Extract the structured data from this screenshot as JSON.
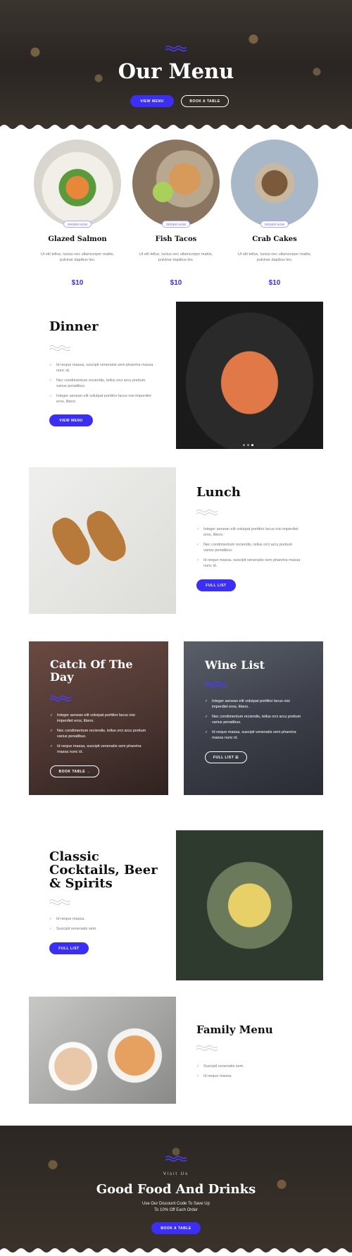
{
  "hero": {
    "title": "Our Menu",
    "view_menu": "VIEW MENU",
    "book_table": "BOOK A TABLE"
  },
  "dishes": [
    {
      "name": "Glazed Salmon",
      "desc": "Ut elit tellus, luctus nec ullamcorper mattis, pulvinar dapibus leo.",
      "price": "$10",
      "order": "ORDER NOW"
    },
    {
      "name": "Fish Tacos",
      "desc": "Ut elit tellus, luctus nec ullamcorper mattis, pulvinar dapibus leo.",
      "price": "$10",
      "order": "ORDER NOW"
    },
    {
      "name": "Crab Cakes",
      "desc": "Ut elit tellus, luctus nec ullamcorper mattis, pulvinar dapibus leo.",
      "price": "$10",
      "order": "ORDER NOW"
    }
  ],
  "dinner": {
    "title": "Dinner",
    "items": [
      "Id neque massa, suscipit venenatis sem pharetra massa nunc id.",
      "Nec condimentum reciendis, tellus orci arcu pretium varius penatibus.",
      "Integer aenean elit volutpat porttitor lacus nisi imperdiet eros, libero."
    ],
    "button": "VIEW MENU"
  },
  "lunch": {
    "title": "Lunch",
    "items": [
      "Integer aenean elit volutpat porttitor lacus nisi imperdiet eros, libero.",
      "Nec condimentum reciendis, tellus orci arcu pretium varius penatibus.",
      "Id neque massa, suscipit venenatis sem pharetra massa nunc id."
    ],
    "button": "FULL LIST"
  },
  "catch": {
    "title": "Catch Of The Day",
    "items": [
      "Integer aenean elit volutpat porttitor lacus nisi imperdiet eros, libero.",
      "Nec condimentum reciendis, tellus orci arcu pretium varius penatibus.",
      "Id neque massa, suscipit venenatis sem pharetra massa nunc id."
    ],
    "button": "BOOK TABLE →"
  },
  "wine": {
    "title": "Wine List",
    "items": [
      "Integer aenean elit volutpat porttitor lacus nisi imperdiet eros, libero.",
      "Nec condimentum reciendis, tellus orci arcu pretium varius penatibus.",
      "Id neque massa, suscipit venenatis sem pharetra massa nunc id."
    ],
    "button": "FULL LIST ☰"
  },
  "cocktails": {
    "title": "Classic Cocktails, Beer & Spirits",
    "items": [
      "Id neque massa.",
      "Suscipit venenatis sem."
    ],
    "button": "FULL LIST"
  },
  "family": {
    "title": "Family Menu",
    "items": [
      "Suscipit venenatis sem.",
      "Id neque massa."
    ]
  },
  "footer": {
    "eyebrow": "Visit Us",
    "title": "Good Food And Drinks",
    "line1": "Use Our Discount Code To Save Up",
    "line2": "To 10% Off Each Order",
    "button": "BOOK A TABLE"
  },
  "colors": {
    "accent": "#3b2ef5"
  }
}
